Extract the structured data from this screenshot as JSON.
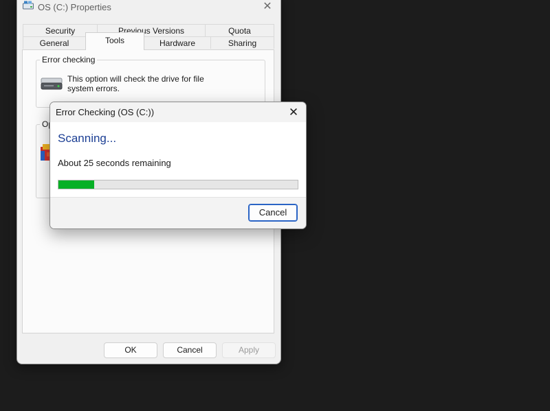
{
  "properties_window": {
    "title": "OS (C:) Properties",
    "icon": "drive-icon",
    "close_glyph": "✕",
    "tabs_row1": [
      {
        "label": "Security"
      },
      {
        "label": "Previous Versions"
      },
      {
        "label": "Quota"
      }
    ],
    "tabs_row2": [
      {
        "label": "General"
      },
      {
        "label": "Tools",
        "active": true
      },
      {
        "label": "Hardware"
      },
      {
        "label": "Sharing"
      }
    ],
    "error_checking": {
      "group_label": "Error checking",
      "description": "This option will check the drive for file system errors.",
      "icon": "hard-drive-icon"
    },
    "optimize": {
      "group_label": "Opti",
      "icon": "defrag-icon"
    },
    "buttons": {
      "ok": "OK",
      "cancel": "Cancel",
      "apply": "Apply"
    }
  },
  "error_dialog": {
    "title": "Error Checking (OS (C:))",
    "close_glyph": "✕",
    "heading": "Scanning...",
    "status": "About 25 seconds remaining",
    "progress_fraction": 0.15,
    "progress_color": "#06b025",
    "cancel_label": "Cancel"
  },
  "colors": {
    "desktop": "#1c1c1c",
    "heading_blue": "#1c3f94",
    "focus_blue": "#2a64c5"
  }
}
